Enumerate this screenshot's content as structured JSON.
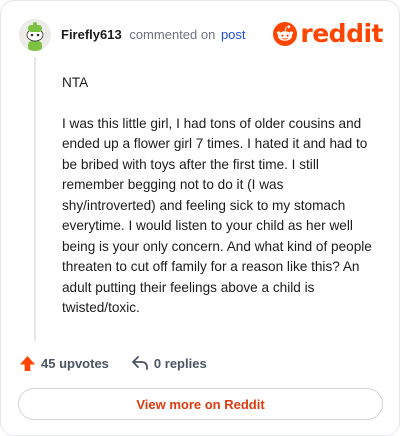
{
  "header": {
    "author": "Firefly613",
    "commented_text": "commented on",
    "post_link": "post"
  },
  "logo": {
    "text": "reddit",
    "color": "#ff4500"
  },
  "comment": {
    "paragraphs": [
      "NTA",
      "I was this little girl, I had tons of older cousins and ended up a flower girl 7 times. I hated it and had to be bribed with toys after the first time. I still remember begging not to do it (I was shy/introverted) and feeling sick to my stomach everytime. I would listen to your child as her well being is your only concern. And what kind of people threaten to cut off family for a reason like this? An adult putting their feelings above a child is twisted/toxic."
    ]
  },
  "actions": {
    "upvotes": "45 upvotes",
    "replies": "0 replies"
  },
  "cta": {
    "label": "View more on Reddit"
  },
  "colors": {
    "accent": "#ff4500",
    "link": "#1d4ed8",
    "cta_text": "#dc3a0f"
  },
  "icons": [
    "avatar",
    "reddit-logo-icon",
    "upvote-arrow-icon",
    "reply-arrow-icon"
  ]
}
